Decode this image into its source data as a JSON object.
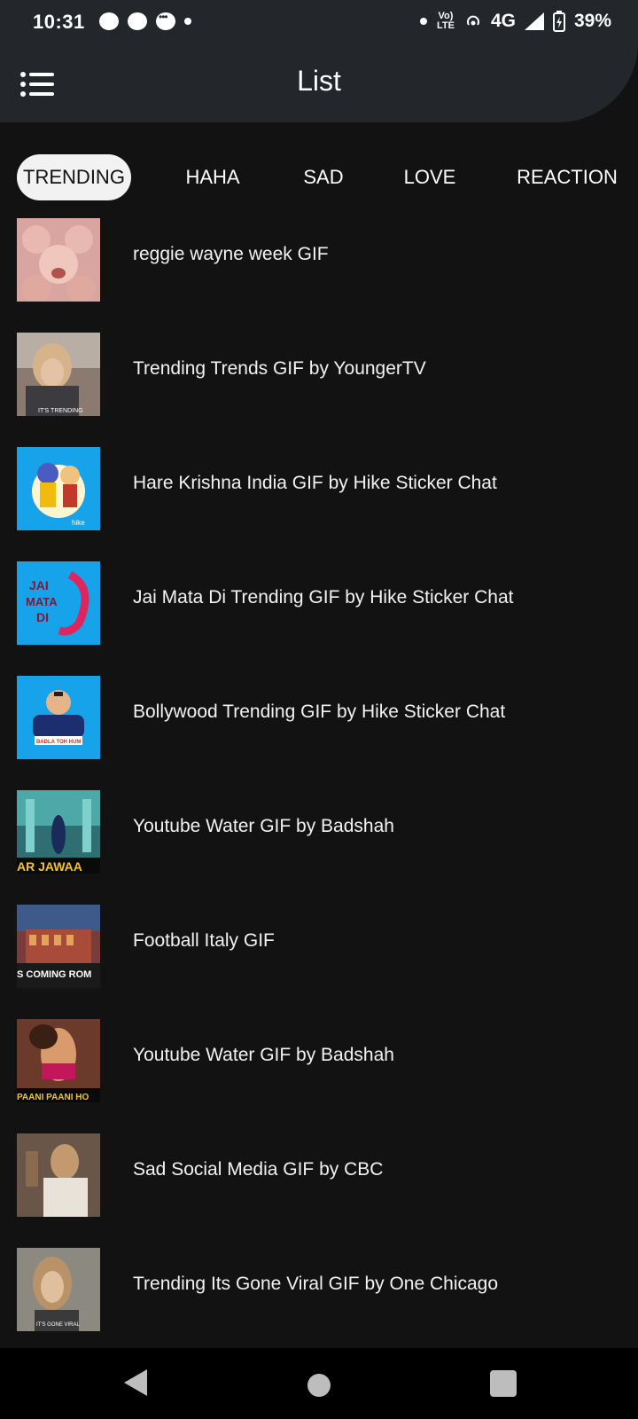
{
  "status_bar": {
    "time": "10:31",
    "network": "4G",
    "volte": "Vo) LTE",
    "battery": "39%"
  },
  "app_bar": {
    "title": "List",
    "menu_icon": "hamburger-menu-icon"
  },
  "tabs": [
    {
      "label": "TRENDING",
      "active": true
    },
    {
      "label": "HAHA",
      "active": false
    },
    {
      "label": "SAD",
      "active": false
    },
    {
      "label": "LOVE",
      "active": false
    },
    {
      "label": "REACTION",
      "active": false
    }
  ],
  "items": [
    {
      "label": "reggie wayne week GIF",
      "thumb_color": "#d9a5a0",
      "thumb_caption": ""
    },
    {
      "label": "Trending Trends GIF by YoungerTV",
      "thumb_color": "#8a7a70",
      "thumb_caption": "IT'S TRENDING"
    },
    {
      "label": "Hare Krishna India GIF by Hike Sticker Chat",
      "thumb_color": "#17a3ea",
      "thumb_caption": "hike"
    },
    {
      "label": "Jai Mata Di Trending GIF by Hike Sticker Chat",
      "thumb_color": "#17a3ea",
      "thumb_caption": "JAI MATA DI"
    },
    {
      "label": "Bollywood Trending GIF by Hike Sticker Chat",
      "thumb_color": "#17a3ea",
      "thumb_caption": "BADLA TOH HUM LENGE HI"
    },
    {
      "label": "Youtube Water GIF by Badshah",
      "thumb_color": "#2f6f74",
      "thumb_caption": "AR JAWAA"
    },
    {
      "label": "Football Italy GIF",
      "thumb_color": "#7a3b3b",
      "thumb_caption": "S COMING ROM"
    },
    {
      "label": "Youtube Water GIF by Badshah",
      "thumb_color": "#6b3a2b",
      "thumb_caption": "PAANI PAANI HO"
    },
    {
      "label": "Sad Social Media GIF by CBC",
      "thumb_color": "#8f7a6a",
      "thumb_caption": ""
    },
    {
      "label": "Trending Its Gone Viral GIF by One Chicago",
      "thumb_color": "#5b5a55",
      "thumb_caption": "IT'S GONE VIRAL"
    }
  ],
  "colors": {
    "background": "#121212",
    "top_bar": "#23272b",
    "active_tab_bg": "#f2f2f2"
  }
}
